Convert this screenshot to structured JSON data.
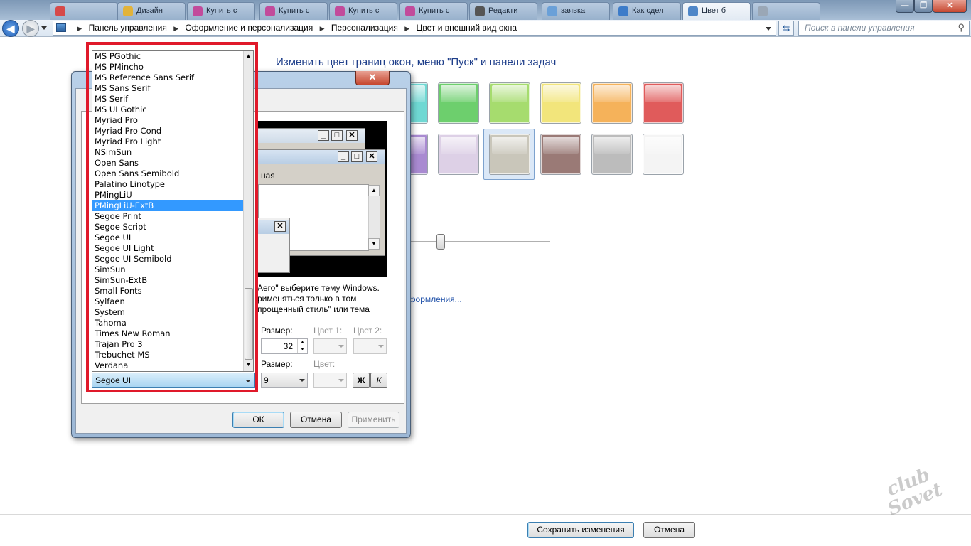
{
  "browser": {
    "tabs": [
      {
        "label": "",
        "color": "#d64949"
      },
      {
        "label": "Дизайн",
        "color": "#e2b33a"
      },
      {
        "label": "Купить с",
        "color": "#c24b9b"
      },
      {
        "label": "Купить с",
        "color": "#c24b9b"
      },
      {
        "label": "Купить с",
        "color": "#c24b9b"
      },
      {
        "label": "Купить с",
        "color": "#c24b9b"
      },
      {
        "label": "Редакти",
        "color": "#555555"
      },
      {
        "label": "заявка",
        "color": "#6aa0d8"
      },
      {
        "label": "Как сдел",
        "color": "#3d7cc9"
      },
      {
        "label": "Цвет б",
        "color": "#4e86c8"
      },
      {
        "label": "",
        "color": "#9aa7b6"
      }
    ],
    "minimize_glyph": "—",
    "maximize_glyph": "❐",
    "close_glyph": "✕"
  },
  "addressbar": {
    "back_glyph": "◀",
    "forward_glyph": "▶",
    "breadcrumbs": [
      "Панель управления",
      "Оформление и персонализация",
      "Персонализация",
      "Цвет и внешний вид окна"
    ],
    "search_placeholder": "Поиск в панели управления"
  },
  "page": {
    "heading": "Изменить цвет границ окон, меню \"Пуск\" и панели задач",
    "swatches_row1": [
      "#6fd8d3",
      "#6dcf6d",
      "#a6dc6e",
      "#f2e57b",
      "#f5b25a",
      "#e05b5b"
    ],
    "swatches_row2": [
      "#a98ad1",
      "#ddd0e6",
      "#c9c6ba",
      "#9a7a76",
      "#bcbcbc",
      "#f4f4f4"
    ],
    "intensity_level": 0.22,
    "advanced_link": "оформления...",
    "save_button": "Сохранить изменения",
    "cancel_button": "Отмена",
    "watermark": "club Sovet"
  },
  "dialog": {
    "close_glyph": "✕",
    "preview_menu_text": "ная",
    "description": "Aero\" выберите тему Windows. рименяться только в том прощенный стиль\" или тема",
    "size_label": "Размер:",
    "color1_label": "Цвет 1:",
    "color2_label": "Цвет 2:",
    "size_value": "32",
    "font_size_label": "Размер:",
    "font_color_label": "Цвет:",
    "font_size_value": "9",
    "bold_label": "Ж",
    "italic_label": "К",
    "ok_button": "ОК",
    "cancel_button": "Отмена",
    "apply_button": "Применить"
  },
  "font_dropdown": {
    "items": [
      "MS PGothic",
      "MS PMincho",
      "MS Reference Sans Serif",
      "MS Sans Serif",
      "MS Serif",
      "MS UI Gothic",
      "Myriad Pro",
      "Myriad Pro Cond",
      "Myriad Pro Light",
      "NSimSun",
      "Open Sans",
      "Open Sans Semibold",
      "Palatino Linotype",
      "PMingLiU",
      "PMingLiU-ExtB",
      "Segoe Print",
      "Segoe Script",
      "Segoe UI",
      "Segoe UI Light",
      "Segoe UI Semibold",
      "SimSun",
      "SimSun-ExtB",
      "Small Fonts",
      "Sylfaen",
      "System",
      "Tahoma",
      "Times New Roman",
      "Trajan Pro 3",
      "Trebuchet MS",
      "Verdana"
    ],
    "highlighted": "PMingLiU-ExtB",
    "selected_value": "Segoe UI",
    "highlight_color": "#e0192a"
  }
}
